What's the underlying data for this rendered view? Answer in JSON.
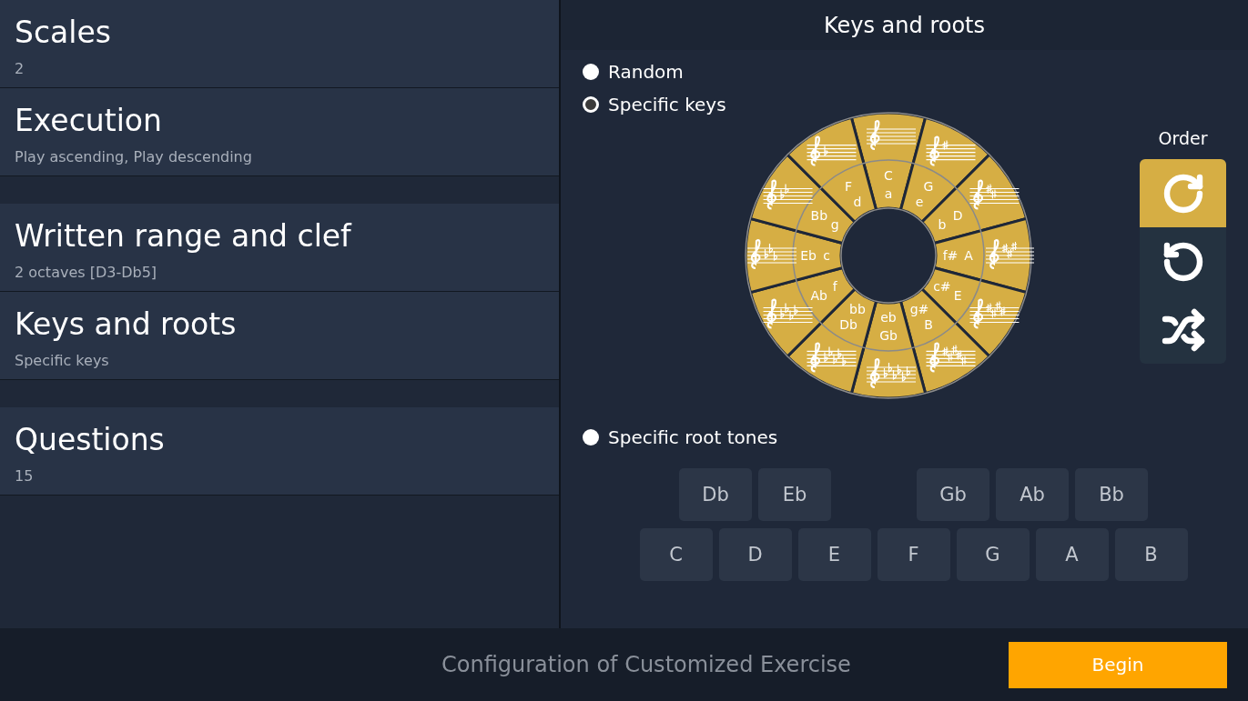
{
  "sidebar": {
    "sections": [
      {
        "items": [
          {
            "title": "Scales",
            "value": "2"
          },
          {
            "title": "Execution",
            "value": "Play ascending, Play descending"
          }
        ]
      },
      {
        "items": [
          {
            "title": "Written range and clef",
            "value": "2 octaves [D3-Db5]"
          },
          {
            "title": "Keys and roots",
            "value": "Specific keys"
          }
        ]
      },
      {
        "items": [
          {
            "title": "Questions",
            "value": "15"
          }
        ]
      }
    ]
  },
  "panel": {
    "title": "Keys and roots",
    "modes": [
      {
        "label": "Random",
        "selected": false
      },
      {
        "label": "Specific keys",
        "selected": true
      }
    ],
    "circle": [
      {
        "major": "C",
        "minor": "a",
        "selected": true
      },
      {
        "major": "G",
        "minor": "e",
        "selected": true
      },
      {
        "major": "D",
        "minor": "b",
        "selected": true
      },
      {
        "major": "A",
        "minor": "f#",
        "selected": true
      },
      {
        "major": "E",
        "minor": "c#",
        "selected": true
      },
      {
        "major": "B",
        "minor": "g#",
        "selected": true
      },
      {
        "major": "Gb",
        "minor": "eb",
        "selected": true
      },
      {
        "major": "Db",
        "minor": "bb",
        "selected": true
      },
      {
        "major": "Ab",
        "minor": "f",
        "selected": true
      },
      {
        "major": "Eb",
        "minor": "c",
        "selected": true
      },
      {
        "major": "Bb",
        "minor": "g",
        "selected": true
      },
      {
        "major": "F",
        "minor": "d",
        "selected": true
      }
    ],
    "order": {
      "label": "Order",
      "options": [
        {
          "kind": "clockwise",
          "selected": true
        },
        {
          "kind": "counterclockwise",
          "selected": false
        },
        {
          "kind": "shuffle",
          "selected": false
        }
      ]
    },
    "root_mode": {
      "label": "Specific root tones",
      "selected": false
    },
    "root_tones": {
      "upper": [
        "Db",
        "Eb",
        "Gb",
        "Ab",
        "Bb"
      ],
      "lower": [
        "C",
        "D",
        "E",
        "F",
        "G",
        "A",
        "B"
      ]
    }
  },
  "footer": {
    "title": "Configuration of Customized Exercise",
    "button": "Begin"
  }
}
